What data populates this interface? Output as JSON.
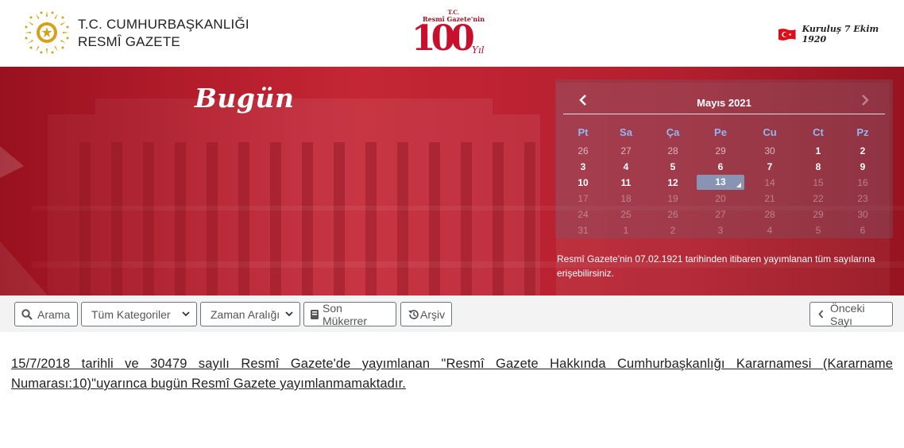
{
  "header": {
    "brand_line1": "T.C. CUMHURBAŞKANLIĞI",
    "brand_line2": "RESMÎ GAZETE",
    "centenary_small1": "T.C.",
    "centenary_small2": "Resmî Gazete'nin",
    "centenary_number": "100",
    "centenary_suffix": "Yıl",
    "founded_text": "Kuruluş 7 Ekim 1920"
  },
  "hero": {
    "title": "Bugün",
    "note": "Resmî Gazete'nin 07.02.1921 tarihinden itibaren yayımlanan tüm sayılarına erişebilirsiniz."
  },
  "calendar": {
    "month_label": "Mayıs 2021",
    "prev_icon": "chevron-left-icon",
    "next_icon": "chevron-right-icon",
    "weekdays": [
      "Pt",
      "Sa",
      "Ça",
      "Pe",
      "Ct",
      "Ct",
      "Pz"
    ],
    "weekdays_display": [
      "Pt",
      "Sa",
      "Ça",
      "Pe",
      "Cu",
      "Ct",
      "Pz"
    ],
    "weeks": [
      [
        "26",
        "27",
        "28",
        "29",
        "30",
        "1",
        "2"
      ],
      [
        "3",
        "4",
        "5",
        "6",
        "7",
        "8",
        "9"
      ],
      [
        "10",
        "11",
        "12",
        "13",
        "14",
        "15",
        "16"
      ],
      [
        "17",
        "18",
        "19",
        "20",
        "21",
        "22",
        "23"
      ],
      [
        "24",
        "25",
        "26",
        "27",
        "28",
        "29",
        "30"
      ],
      [
        "31",
        "1",
        "2",
        "3",
        "4",
        "5",
        "6"
      ]
    ],
    "selected_day": "13"
  },
  "toolbar": {
    "search_label": "Arama",
    "category_selected": "Tüm Kategoriler",
    "date_range_selected": "Zaman Aralığı",
    "duplicates_label": "Son Mükerrer",
    "archive_label": "Arşiv",
    "previous_label": "Önceki Sayı"
  },
  "main": {
    "notice": "15/7/2018 tarihli ve 30479 sayılı Resmî Gazete'de yayımlanan \"Resmî Gazete Hakkında Cumhurbaşkanlığı Kararnamesi (Kararname Numarası:10)\"uyarınca bugün Resmî Gazete yayımlanmamaktadır."
  },
  "colors": {
    "brand_red": "#c8102e",
    "hero_red": "#b82130",
    "weekday_blue": "#8fb8f0",
    "selected_day_bg": "#8994b5"
  }
}
